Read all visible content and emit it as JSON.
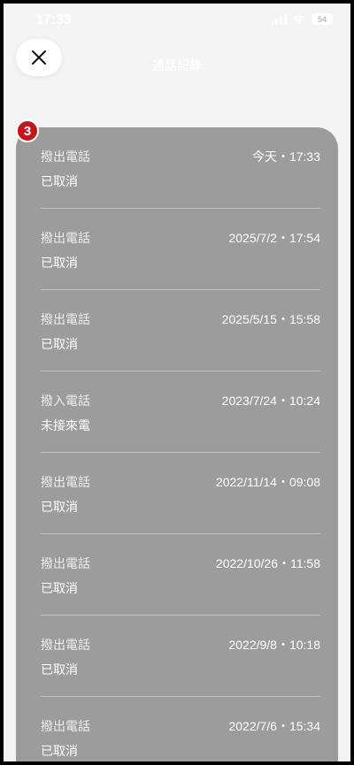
{
  "status_bar": {
    "time": "17:33",
    "battery": "54"
  },
  "nav": {
    "title": "通話記錄"
  },
  "badge": {
    "count": "3"
  },
  "calls": [
    {
      "type": "撥出電話",
      "status": "已取消",
      "datetime": "今天・17:33"
    },
    {
      "type": "撥出電話",
      "status": "已取消",
      "datetime": "2025/7/2・17:54"
    },
    {
      "type": "撥出電話",
      "status": "已取消",
      "datetime": "2025/5/15・15:58"
    },
    {
      "type": "撥入電話",
      "status": "未接來電",
      "datetime": "2023/7/24・10:24"
    },
    {
      "type": "撥出電話",
      "status": "已取消",
      "datetime": "2022/11/14・09:08"
    },
    {
      "type": "撥出電話",
      "status": "已取消",
      "datetime": "2022/10/26・11:58"
    },
    {
      "type": "撥出電話",
      "status": "已取消",
      "datetime": "2022/9/8・10:18"
    },
    {
      "type": "撥出電話",
      "status": "已取消",
      "datetime": "2022/7/6・15:34"
    }
  ]
}
